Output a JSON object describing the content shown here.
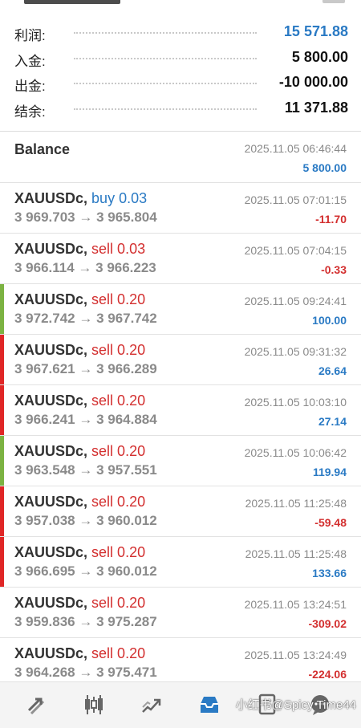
{
  "summary": {
    "profit_label": "利润:",
    "profit_value": "15 571.88",
    "deposit_label": "入金:",
    "deposit_value": "5 800.00",
    "withdrawal_label": "出金:",
    "withdrawal_value": "-10 000.00",
    "balance_label": "结余:",
    "balance_value": "11 371.88"
  },
  "balance_entry": {
    "title": "Balance",
    "time": "2025.11.05 06:46:44",
    "amount": "5 800.00"
  },
  "trades": [
    {
      "symbol": "XAUUSDc,",
      "type": "buy 0.03",
      "prices": "3 969.703 → 3 965.804",
      "time": "2025.11.05 07:01:15",
      "profit": "-11.70"
    },
    {
      "symbol": "XAUUSDc,",
      "type": "sell 0.03",
      "prices": "3 966.114 → 3 966.223",
      "time": "2025.11.05 07:04:15",
      "profit": "-0.33"
    },
    {
      "symbol": "XAUUSDc,",
      "type": "sell 0.20",
      "prices": "3 972.742 → 3 967.742",
      "time": "2025.11.05 09:24:41",
      "profit": "100.00"
    },
    {
      "symbol": "XAUUSDc,",
      "type": "sell 0.20",
      "prices": "3 967.621 → 3 966.289",
      "time": "2025.11.05 09:31:32",
      "profit": "26.64"
    },
    {
      "symbol": "XAUUSDc,",
      "type": "sell 0.20",
      "prices": "3 966.241 → 3 964.884",
      "time": "2025.11.05 10:03:10",
      "profit": "27.14"
    },
    {
      "symbol": "XAUUSDc,",
      "type": "sell 0.20",
      "prices": "3 963.548 → 3 957.551",
      "time": "2025.11.05 10:06:42",
      "profit": "119.94"
    },
    {
      "symbol": "XAUUSDc,",
      "type": "sell 0.20",
      "prices": "3 957.038 → 3 960.012",
      "time": "2025.11.05 11:25:48",
      "profit": "-59.48"
    },
    {
      "symbol": "XAUUSDc,",
      "type": "sell 0.20",
      "prices": "3 966.695 → 3 960.012",
      "time": "2025.11.05 11:25:48",
      "profit": "133.66"
    },
    {
      "symbol": "XAUUSDc,",
      "type": "sell 0.20",
      "prices": "3 959.836 → 3 975.287",
      "time": "2025.11.05 13:24:51",
      "profit": "-309.02"
    },
    {
      "symbol": "XAUUSDc,",
      "type": "sell 0.20",
      "prices": "3 964.268 → 3 975.471",
      "time": "2025.11.05 13:24:49",
      "profit": "-224.06"
    }
  ],
  "nav": {
    "items": [
      "quotes-icon",
      "chart-icon",
      "trade-icon",
      "history-icon",
      "news-icon",
      "messages-icon"
    ],
    "active": "history-icon"
  },
  "watermark": "小红书@Spicy Time44",
  "colors": {
    "accent_blue": "#2a7ac4",
    "loss_red": "#d32f2f",
    "stripe_green": "#7cb342",
    "stripe_red": "#e02626"
  }
}
